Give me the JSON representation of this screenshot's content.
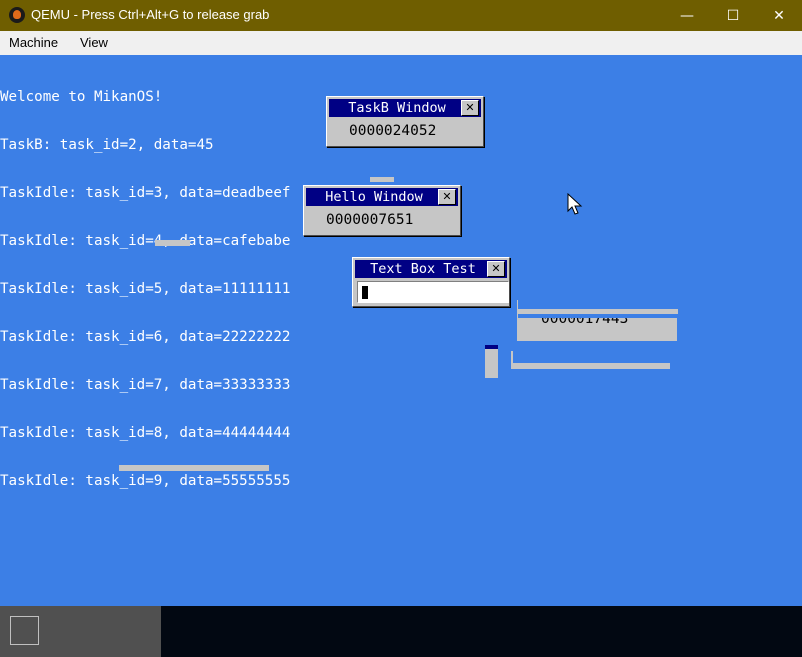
{
  "qemu": {
    "title": "QEMU - Press Ctrl+Alt+G to release grab",
    "minimize_glyph": "—",
    "maximize_glyph": "☐",
    "close_glyph": "✕",
    "menu": [
      "Machine",
      "View"
    ]
  },
  "console": {
    "lines": [
      "Welcome to MikanOS!",
      "TaskB: task_id=2, data=45",
      "TaskIdle: task_id=3, data=deadbeef",
      "TaskIdle: task_id=4, data=cafebabe",
      "TaskIdle: task_id=5, data=11111111",
      "TaskIdle: task_id=6, data=22222222",
      "TaskIdle: task_id=7, data=33333333",
      "TaskIdle: task_id=8, data=44444444",
      "TaskIdle: task_id=9, data=55555555"
    ]
  },
  "windows": {
    "taskb": {
      "title": "TaskB Window",
      "value": "0000024052"
    },
    "hello": {
      "title": "Hello Window",
      "value": "0000007651"
    },
    "textbox": {
      "title": "Text Box Test",
      "value": ""
    },
    "close_glyph": "✕"
  },
  "fragment": {
    "partial_counter": "0000017443"
  },
  "colors": {
    "desktop": "#3c7fe6",
    "title_bar": "#000084",
    "window_face": "#c6c6c6",
    "qemu_title": "#6f5e00"
  }
}
